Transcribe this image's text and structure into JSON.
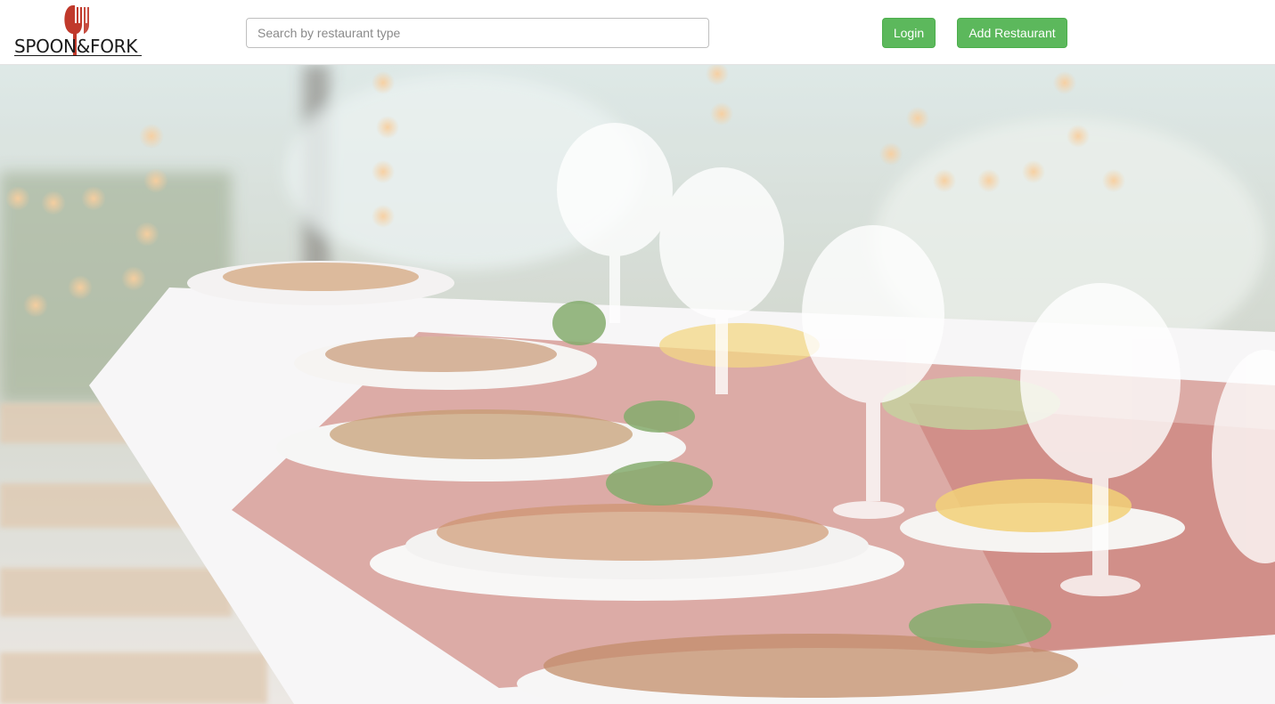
{
  "brand": {
    "name": "SPOON&FORK",
    "logo_icon": "fork-spoon-icon",
    "accent_color": "#c0392b"
  },
  "search": {
    "placeholder": "Search by restaurant type",
    "value": ""
  },
  "nav": {
    "login_label": "Login",
    "add_restaurant_label": "Add Restaurant",
    "button_color": "#5cb85c"
  },
  "hero": {
    "image_subject": "dining-table-photo"
  }
}
